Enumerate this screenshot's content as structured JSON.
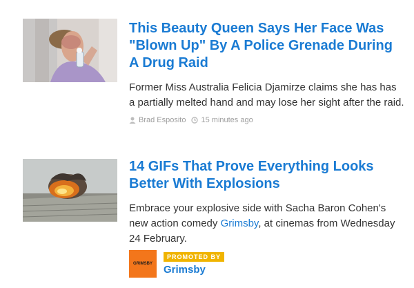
{
  "articles": [
    {
      "title": "This Beauty Queen Says Her Face Was \"Blown Up\" By A Police Grenade During A Drug Raid",
      "description": "Former Miss Australia Felicia Djamirze claims she has has a partially melted hand and may lose her sight after the raid.",
      "author": "Brad Esposito",
      "time": "15 minutes ago",
      "author_icon": "user-icon",
      "time_icon": "clock-icon"
    },
    {
      "title": "14 GIFs That Prove Everything Looks Better With Explosions",
      "description_before": "Embrace your explosive side with Sacha Baron Cohen's new action comedy ",
      "description_link": "Grimsby",
      "description_after": ", at cinemas from Wednesday 24 February.",
      "promoted_label": "PROMOTED BY",
      "brand": "Grimsby",
      "brand_logo_text": "GRIMSBY"
    }
  ],
  "colors": {
    "link": "#1a7bd3",
    "badge": "#f0b400",
    "logo_bg": "#f3761b",
    "meta": "#9e9e9e"
  }
}
